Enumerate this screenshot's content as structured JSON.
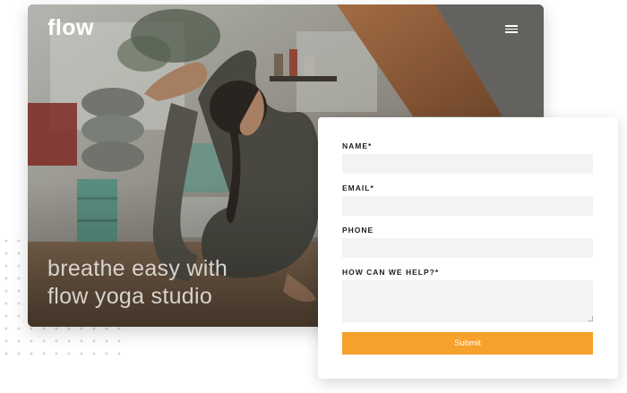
{
  "brand": {
    "logo_text": "flow",
    "headline_line1": "breathe easy with",
    "headline_line2": "flow yoga studio"
  },
  "header": {
    "menu_icon": "hamburger-menu-icon"
  },
  "form": {
    "fields": [
      {
        "label": "NAME*",
        "value": "",
        "placeholder": ""
      },
      {
        "label": "EMAIL*",
        "value": "",
        "placeholder": ""
      },
      {
        "label": "PHONE",
        "value": "",
        "placeholder": ""
      },
      {
        "label": "HOW CAN WE HELP?*",
        "value": "",
        "placeholder": ""
      }
    ],
    "submit_label": "Submit"
  },
  "colors": {
    "accent": "#f5a12c",
    "input_bg": "#f3f3f4",
    "headline": "#d8d3cc"
  }
}
